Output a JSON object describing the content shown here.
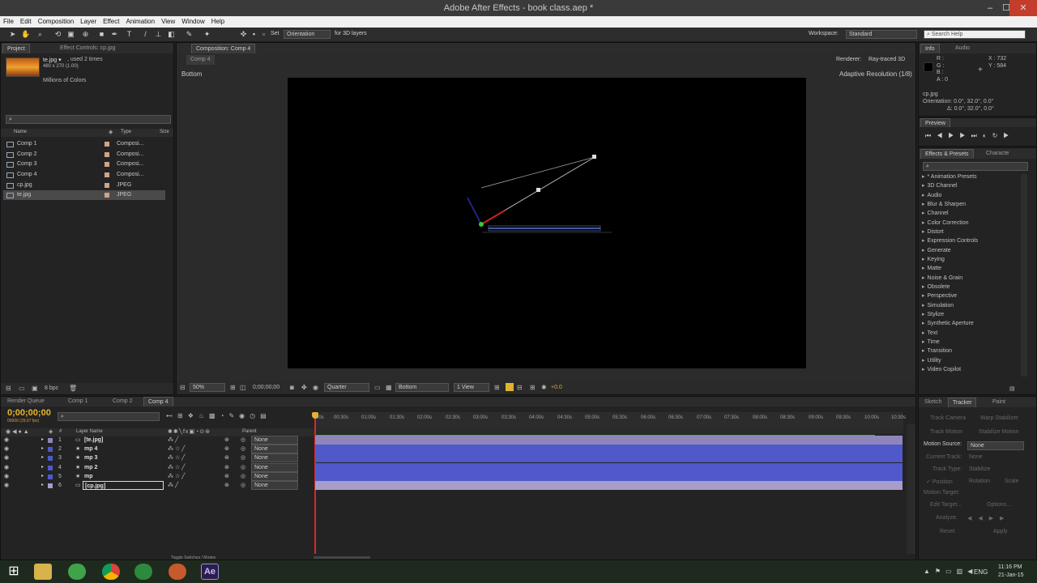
{
  "window": {
    "title": "Adobe After Effects - book class.aep *",
    "min": "–",
    "max": "☐",
    "close": "✕"
  },
  "menu": [
    "File",
    "Edit",
    "Composition",
    "Layer",
    "Effect",
    "Animation",
    "View",
    "Window",
    "Help"
  ],
  "toolbar": {
    "axis_label": "Set",
    "axis_mode": "Orientation",
    "axis_hint": "for 3D layers",
    "workspace_label": "Workspace:",
    "workspace_value": "Standard",
    "search_placeholder": "Search Help"
  },
  "project": {
    "tab_project": "Project",
    "tab_effect_controls": "Effect Controls: cp.jpg",
    "selected_name": "te.jpg ▾",
    "used": ", used 2 times",
    "dims": "480 x 270 (1.00)",
    "colors": "Millions of Colors",
    "columns": {
      "name": "Name",
      "type": "Type",
      "size": "Size"
    },
    "items": [
      {
        "name": "Comp 1",
        "type": "Composi..."
      },
      {
        "name": "Comp 2",
        "type": "Composi..."
      },
      {
        "name": "Comp 3",
        "type": "Composi..."
      },
      {
        "name": "Comp 4",
        "type": "Composi..."
      },
      {
        "name": "cp.jpg",
        "type": "JPEG"
      },
      {
        "name": "te.jpg",
        "type": "JPEG"
      }
    ],
    "bpc": "8 bpc"
  },
  "composition": {
    "tab": "Composition: Comp 4",
    "subtab": "Comp 4",
    "renderer_label": "Renderer:",
    "renderer_value": "Ray-traced 3D",
    "view_label": "Bottom",
    "resolution_note": "Adaptive Resolution (1/8)",
    "zoom": "50%",
    "timecode": "0;00;00;00",
    "quality": "Quarter",
    "camera": "Bottom",
    "views": "1 View",
    "exposure": "+0.0"
  },
  "info": {
    "tab_info": "Info",
    "tab_audio": "Audio",
    "r": "R :",
    "g": "G :",
    "b": "B :",
    "a": "A : 0",
    "x": "X : 732",
    "y": "Y : 584",
    "layer": "cp.jpg",
    "orientation": "Orientation: 0.0°, 32.0°, 0.0°",
    "delta": "Δ: 0.0°, 32.0°, 0.0°"
  },
  "preview": {
    "tab": "Preview"
  },
  "effects": {
    "tab": "Effects & Presets",
    "tab2": "Characte",
    "items": [
      "* Animation Presets",
      "3D Channel",
      "Audio",
      "Blur & Sharpen",
      "Channel",
      "Color Correction",
      "Distort",
      "Expression Controls",
      "Generate",
      "Keying",
      "Matte",
      "Noise & Grain",
      "Obsolete",
      "Perspective",
      "Simulation",
      "Stylize",
      "Synthetic Aperture",
      "Text",
      "Time",
      "Transition",
      "Utility",
      "Video Copilot"
    ]
  },
  "timeline_tabs": [
    "Render Queue",
    "Comp 1",
    "Comp 2",
    "Comp 4"
  ],
  "timeline": {
    "timecode": "0;00;00;00",
    "fps": "00000 (29.97 fps)",
    "col_layer": "Layer Name",
    "col_num": "#",
    "col_parent": "Parent",
    "ticks": [
      "00s",
      "00:30s",
      "01:00s",
      "01:30s",
      "02:00s",
      "02:30s",
      "03:00s",
      "03:30s",
      "04:00s",
      "04:30s",
      "05:00s",
      "05:30s",
      "06:00s",
      "06:30s",
      "07:00s",
      "07:30s",
      "08:00s",
      "08:30s",
      "09:00s",
      "09:30s",
      "10:00s",
      "10:30s"
    ],
    "layers": [
      {
        "num": "1",
        "name": "[te.jpg]",
        "parent": "None",
        "color": "#8e86ba"
      },
      {
        "num": "2",
        "name": "mp 4",
        "parent": "None",
        "color": "#4f59c9"
      },
      {
        "num": "3",
        "name": "mp 3",
        "parent": "None",
        "color": "#4f59c9"
      },
      {
        "num": "4",
        "name": "mp 2",
        "parent": "None",
        "color": "#4f59c9"
      },
      {
        "num": "5",
        "name": "mp",
        "parent": "None",
        "color": "#4f59c9"
      },
      {
        "num": "6",
        "name": "[cp.jpg]",
        "parent": "None",
        "color": "#a69ec9"
      }
    ],
    "toggle_label": "Toggle Switches / Modes"
  },
  "tracker": {
    "tabs": [
      "Sketch",
      "Tracker",
      "Paint"
    ],
    "track_camera": "Track Camera",
    "warp_stabilizer": "Warp Stabilizer",
    "track_motion": "Track Motion",
    "stabilize_motion": "Stabilize Motion",
    "motion_source_label": "Motion Source:",
    "motion_source_value": "None",
    "current_track_label": "Current Track:",
    "current_track_value": "None",
    "track_type_label": "Track Type:",
    "track_type_value": "Stabilize",
    "position": "Position",
    "rotation": "Rotation",
    "scale": "Scale",
    "motion_target": "Motion Target:",
    "edit_target": "Edit Target...",
    "options": "Options...",
    "analyze": "Analyze:",
    "reset": "Reset",
    "apply": "Apply"
  },
  "taskbar": {
    "lang": "ENG",
    "time": "11:16 PM",
    "date": "21-Jan-15"
  }
}
